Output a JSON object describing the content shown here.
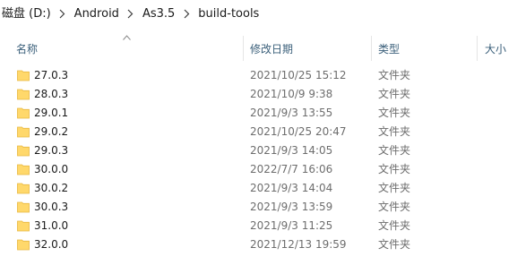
{
  "breadcrumb": {
    "items": [
      {
        "label": "磁盘 (D:)"
      },
      {
        "label": "Android"
      },
      {
        "label": "As3.5"
      },
      {
        "label": "build-tools"
      }
    ]
  },
  "columns": {
    "name": "名称",
    "date": "修改日期",
    "type": "类型",
    "size": "大小",
    "sort_column": "name",
    "sort_direction": "ascending"
  },
  "colors": {
    "folder": "#ffd86b",
    "folder_dark": "#e9b840",
    "header_text": "#3a5f7a",
    "secondary_text": "#6d6d6d"
  },
  "rows": [
    {
      "name": "27.0.3",
      "date": "2021/10/25 15:12",
      "type": "文件夹",
      "icon": "folder-icon"
    },
    {
      "name": "28.0.3",
      "date": "2021/10/9 9:38",
      "type": "文件夹",
      "icon": "folder-icon"
    },
    {
      "name": "29.0.1",
      "date": "2021/9/3 13:55",
      "type": "文件夹",
      "icon": "folder-icon"
    },
    {
      "name": "29.0.2",
      "date": "2021/10/25 20:47",
      "type": "文件夹",
      "icon": "folder-icon"
    },
    {
      "name": "29.0.3",
      "date": "2021/9/3 14:05",
      "type": "文件夹",
      "icon": "folder-icon"
    },
    {
      "name": "30.0.0",
      "date": "2022/7/7 16:06",
      "type": "文件夹",
      "icon": "folder-icon"
    },
    {
      "name": "30.0.2",
      "date": "2021/9/3 14:04",
      "type": "文件夹",
      "icon": "folder-icon"
    },
    {
      "name": "30.0.3",
      "date": "2021/9/3 13:59",
      "type": "文件夹",
      "icon": "folder-icon"
    },
    {
      "name": "31.0.0",
      "date": "2021/9/3 11:25",
      "type": "文件夹",
      "icon": "folder-icon"
    },
    {
      "name": "32.0.0",
      "date": "2021/12/13 19:59",
      "type": "文件夹",
      "icon": "folder-icon"
    }
  ]
}
